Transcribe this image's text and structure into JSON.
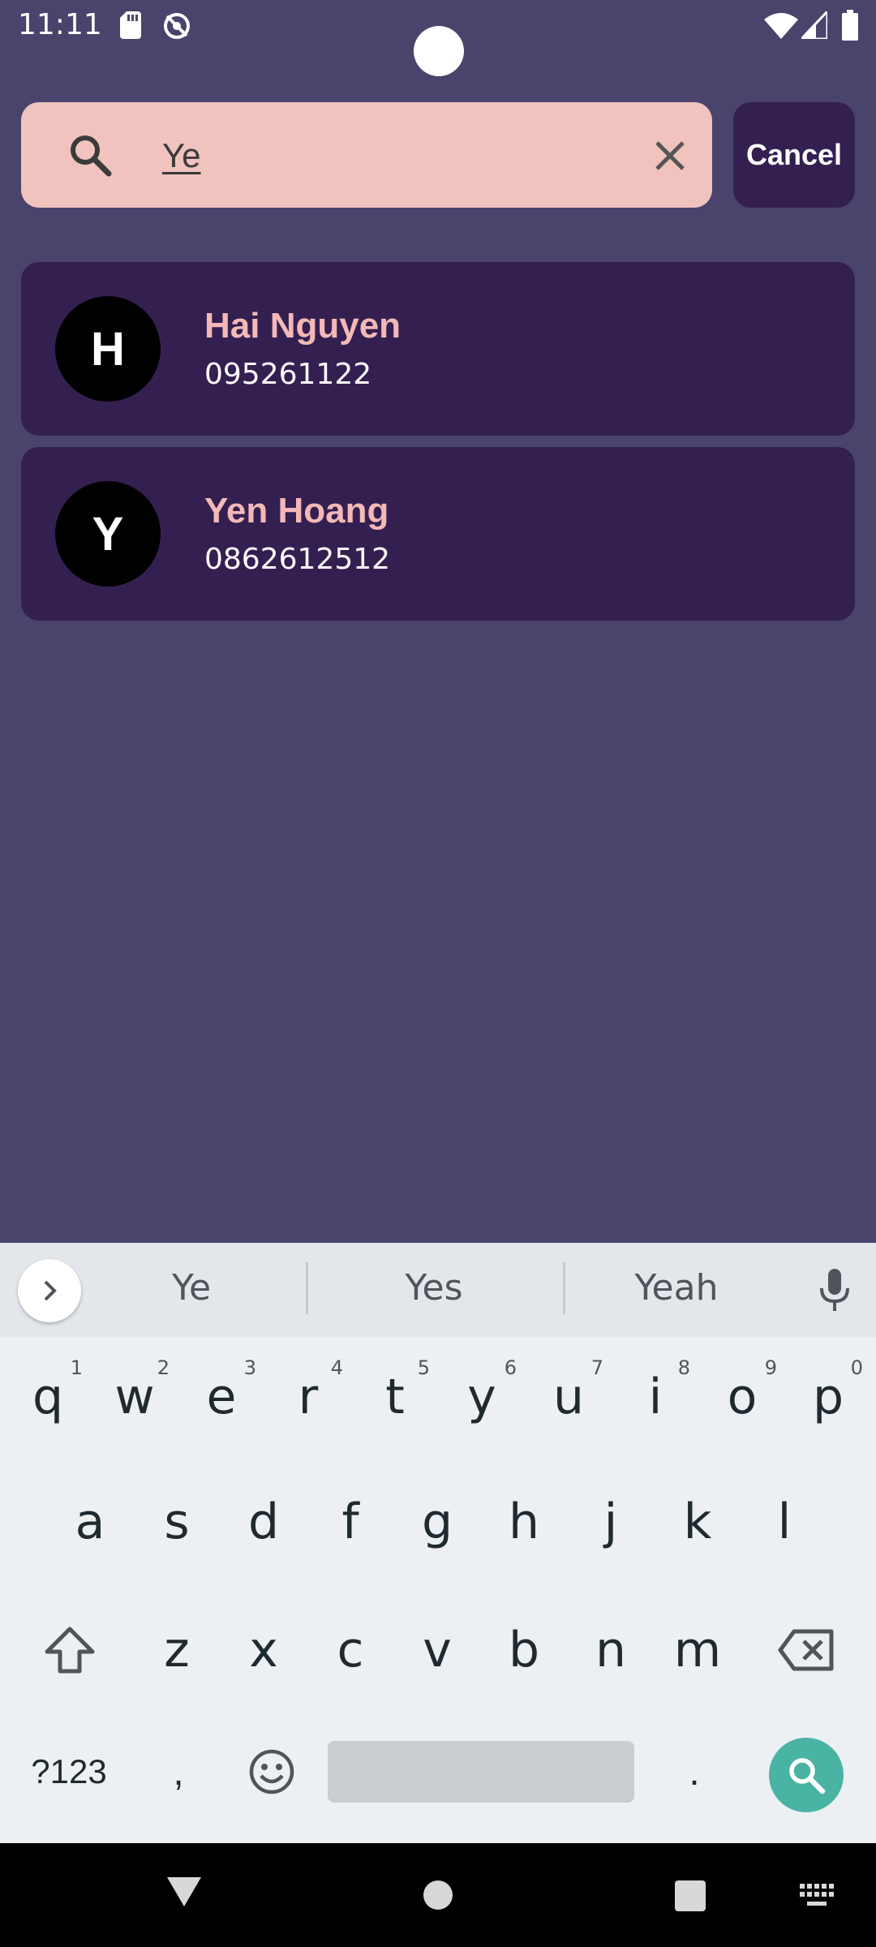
{
  "status_bar": {
    "time": "11:11",
    "icons": [
      "sd-card-icon",
      "sync-off-icon",
      "wifi-icon",
      "signal-icon",
      "battery-icon"
    ]
  },
  "search": {
    "value": "Ye",
    "icon": "search-icon",
    "clear_icon": "close-icon",
    "cancel_label": "Cancel"
  },
  "contacts": [
    {
      "initial": "H",
      "name": "Hai Nguyen",
      "phone": "095261122"
    },
    {
      "initial": "Y",
      "name": "Yen Hoang",
      "phone": "0862612512"
    }
  ],
  "keyboard": {
    "suggestions": [
      "Ye",
      "Yes",
      "Yeah"
    ],
    "row1": [
      {
        "key": "q",
        "hint": "1"
      },
      {
        "key": "w",
        "hint": "2"
      },
      {
        "key": "e",
        "hint": "3"
      },
      {
        "key": "r",
        "hint": "4"
      },
      {
        "key": "t",
        "hint": "5"
      },
      {
        "key": "y",
        "hint": "6"
      },
      {
        "key": "u",
        "hint": "7"
      },
      {
        "key": "i",
        "hint": "8"
      },
      {
        "key": "o",
        "hint": "9"
      },
      {
        "key": "p",
        "hint": "0"
      }
    ],
    "row2": [
      "a",
      "s",
      "d",
      "f",
      "g",
      "h",
      "j",
      "k",
      "l"
    ],
    "row3": [
      "z",
      "x",
      "c",
      "v",
      "b",
      "n",
      "m"
    ],
    "symbols_label": "?123",
    "comma_label": ",",
    "period_label": "."
  },
  "colors": {
    "background": "#4A436B",
    "card": "#341F51",
    "search_field": "#F0C3BF",
    "name_text": "#F4B9B6",
    "action_key": "#49B3A4"
  }
}
